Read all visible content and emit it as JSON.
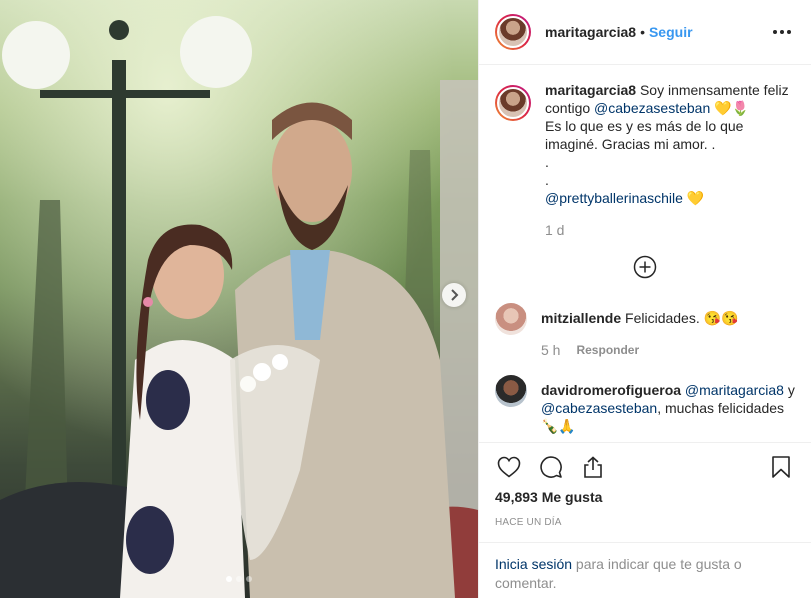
{
  "post": {
    "username": "maritagarcia8",
    "separator": "•",
    "follow_label": "Seguir",
    "more_icon": "more-options-icon"
  },
  "caption": {
    "username": "maritagarcia8",
    "line1_text": "Soy inmensamente feliz contigo",
    "mention1": "@cabezasesteban",
    "emojis1": "💛🌷",
    "line2": "Es lo que es y es más de lo que imaginé. Gracias mi amor. .",
    "dot1": ".",
    "dot2": ".",
    "mention2": "@prettyballerinaschile",
    "emojis2": "💛",
    "time": "1 d"
  },
  "load_more_icon": "plus-circle-icon",
  "comments": [
    {
      "username": "mitziallende",
      "text": "Felicidades. 😘😘",
      "time": "5 h",
      "reply_label": "Responder"
    },
    {
      "username": "davidromerofigueroa",
      "mention_a": "@maritagarcia8",
      "conj": "y",
      "mention_b": "@cabezasesteban",
      "text": ", muchas felicidades 🍾🙏"
    }
  ],
  "actions": {
    "like_icon": "heart-icon",
    "comment_icon": "comment-icon",
    "share_icon": "share-icon",
    "save_icon": "bookmark-icon"
  },
  "likes": "49,893 Me gusta",
  "date": "HACE UN DÍA",
  "login": {
    "link": "Inicia sesión",
    "text": " para indicar que te gusta o comentar."
  },
  "carousel": {
    "next_icon": "chevron-right-icon",
    "dots": 3,
    "active_dot": 1
  },
  "colors": {
    "link_blue": "#3897f0",
    "mention_navy": "#003569",
    "muted_gray": "#8e8e8e"
  }
}
